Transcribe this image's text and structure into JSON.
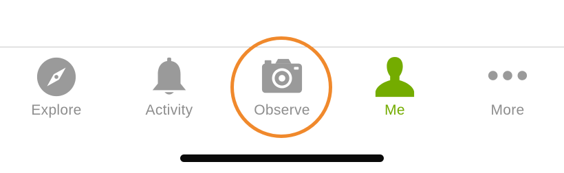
{
  "tabbar": {
    "tabs": [
      {
        "id": "explore",
        "label": "Explore",
        "icon": "compass-icon",
        "active": false
      },
      {
        "id": "activity",
        "label": "Activity",
        "icon": "bell-icon",
        "active": false
      },
      {
        "id": "observe",
        "label": "Observe",
        "icon": "camera-icon",
        "active": false
      },
      {
        "id": "me",
        "label": "Me",
        "icon": "person-icon",
        "active": true
      },
      {
        "id": "more",
        "label": "More",
        "icon": "more-dots-icon",
        "active": false
      }
    ]
  },
  "colors": {
    "inactive": "#8e8e8e",
    "icon_gray": "#9a9a9a",
    "active_green": "#74ac00",
    "highlight_orange": "#f0892c",
    "home_indicator": "#0a0a0a"
  }
}
